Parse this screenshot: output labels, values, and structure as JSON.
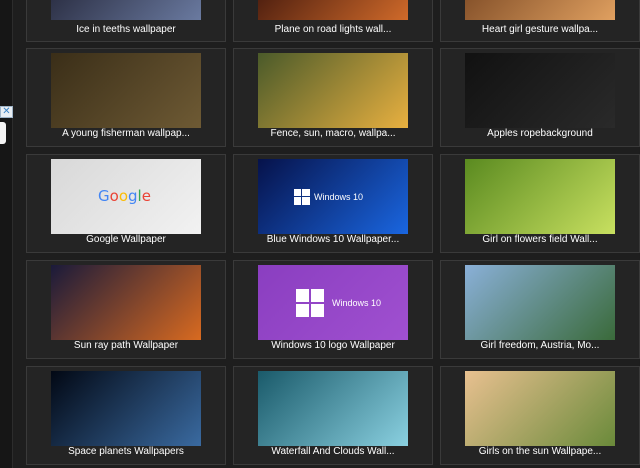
{
  "ad": {
    "close_glyph": "✕",
    "icon": "close-icon"
  },
  "tiles": [
    {
      "caption": "Ice in teeths wallpaper",
      "colors": [
        "#1a1a2a",
        "#6a7aa0"
      ]
    },
    {
      "caption": "Plane on road lights wall...",
      "colors": [
        "#2a0a08",
        "#d06a2a"
      ]
    },
    {
      "caption": "Heart girl gesture wallpa...",
      "colors": [
        "#6a3a1a",
        "#e0a060"
      ]
    },
    {
      "caption": "A young fisherman wallpap...",
      "colors": [
        "#3a2e18",
        "#6e5a34"
      ]
    },
    {
      "caption": "Fence, sun, macro, wallpa...",
      "colors": [
        "#4a5a2a",
        "#e8b040"
      ]
    },
    {
      "caption": "Apples ropebackground",
      "colors": [
        "#111111",
        "#2a2a2a"
      ]
    },
    {
      "caption": "Google Wallpaper",
      "colors": [
        "#d8d8d8",
        "#f2f2f2"
      ],
      "logo": "Google"
    },
    {
      "caption": "Blue Windows 10 Wallpaper...",
      "colors": [
        "#06124a",
        "#1a66e0"
      ],
      "logo": "Windows 10"
    },
    {
      "caption": "Girl on flowers field Wall...",
      "colors": [
        "#5a8a20",
        "#c8e060"
      ]
    },
    {
      "caption": "Sun ray path Wallpaper",
      "colors": [
        "#1a1a3a",
        "#d86a20"
      ]
    },
    {
      "caption": "Windows 10 logo Wallpaper",
      "colors": [
        "#8a3ec0",
        "#a050d0"
      ],
      "logo": "Windows 10"
    },
    {
      "caption": "Girl freedom, Austria, Mo...",
      "colors": [
        "#8ab0d8",
        "#3a6a3a"
      ]
    },
    {
      "caption": "Space planets Wallpapers",
      "colors": [
        "#020814",
        "#3a6aa0"
      ]
    },
    {
      "caption": "Waterfall And Clouds Wall...",
      "colors": [
        "#1a5a6a",
        "#8ad0e0"
      ]
    },
    {
      "caption": "Girls on the sun Wallpape...",
      "colors": [
        "#e8c090",
        "#6a8a3a"
      ]
    }
  ]
}
